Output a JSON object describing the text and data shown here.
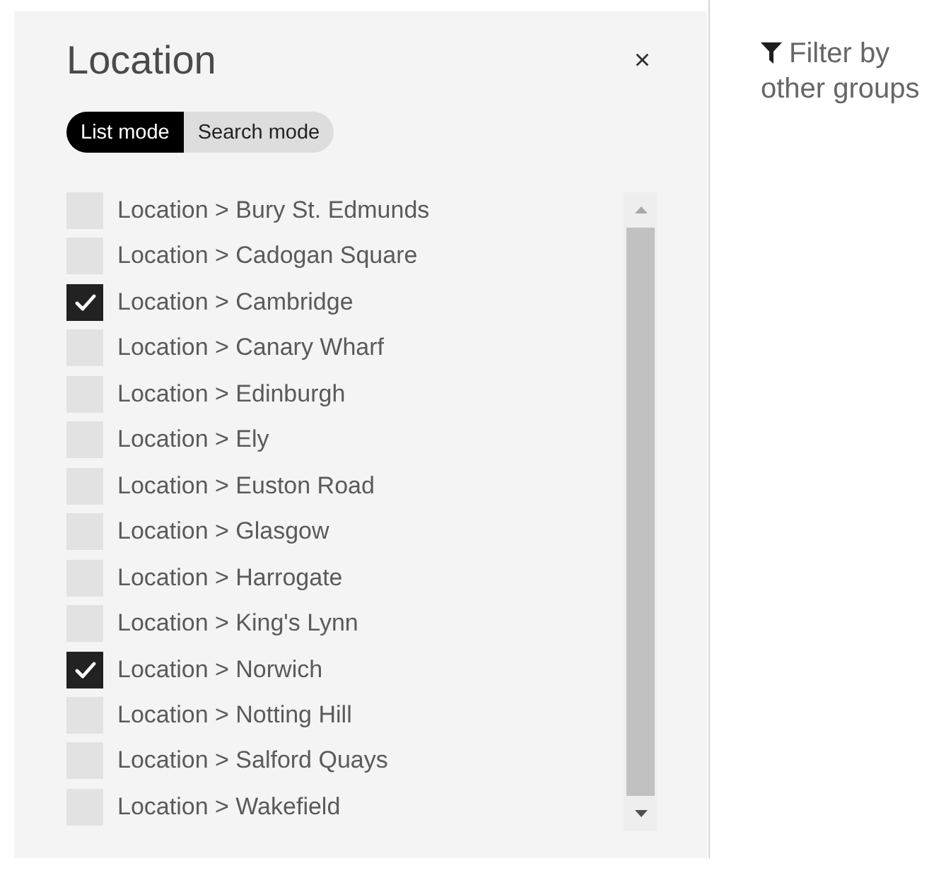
{
  "panel": {
    "title": "Location",
    "close_button": "×",
    "modes": [
      {
        "label": "List mode",
        "selected": true
      },
      {
        "label": "Search mode",
        "selected": false
      }
    ],
    "options": [
      {
        "label": "Location > Bury St. Edmunds",
        "checked": false
      },
      {
        "label": "Location > Cadogan Square",
        "checked": false
      },
      {
        "label": "Location > Cambridge",
        "checked": true
      },
      {
        "label": "Location > Canary Wharf",
        "checked": false
      },
      {
        "label": "Location > Edinburgh",
        "checked": false
      },
      {
        "label": "Location > Ely",
        "checked": false
      },
      {
        "label": "Location > Euston Road",
        "checked": false
      },
      {
        "label": "Location > Glasgow",
        "checked": false
      },
      {
        "label": "Location > Harrogate",
        "checked": false
      },
      {
        "label": "Location > King's Lynn",
        "checked": false
      },
      {
        "label": "Location > Norwich",
        "checked": true
      },
      {
        "label": "Location > Notting Hill",
        "checked": false
      },
      {
        "label": "Location > Salford Quays",
        "checked": false
      },
      {
        "label": "Location > Wakefield",
        "checked": false
      }
    ]
  },
  "filter_link": {
    "label": "Filter by other groups"
  }
}
